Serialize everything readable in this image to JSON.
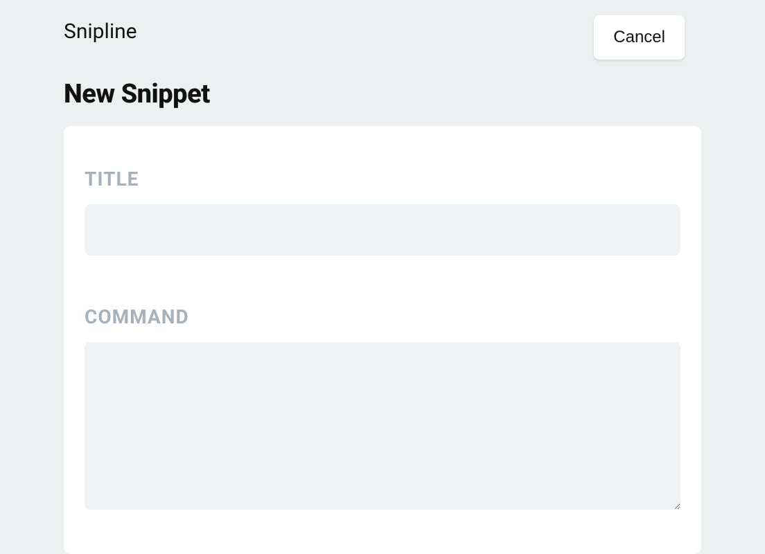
{
  "header": {
    "app_title": "Snipline",
    "cancel_label": "Cancel"
  },
  "page": {
    "title": "New Snippet"
  },
  "form": {
    "title_label": "TITLE",
    "title_value": "",
    "command_label": "COMMAND",
    "command_value": ""
  }
}
